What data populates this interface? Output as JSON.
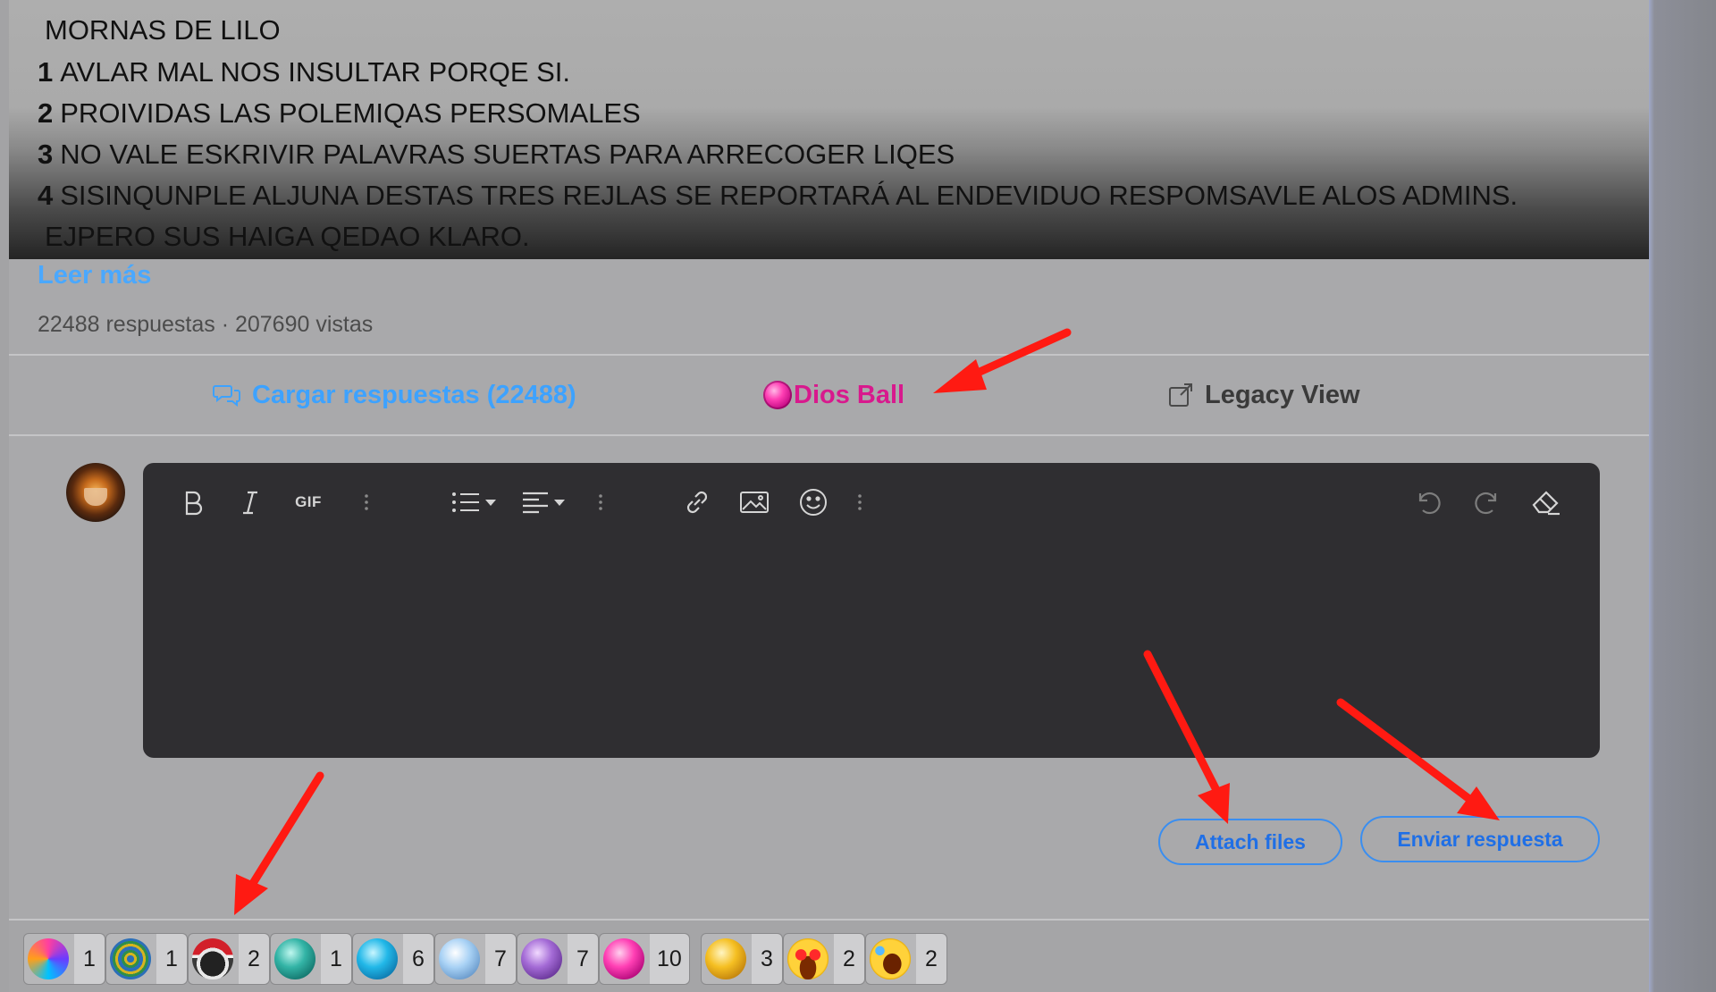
{
  "post": {
    "rules": [
      {
        "num": "",
        "text": "MORNAS DE LILO"
      },
      {
        "num": "1",
        "text": "AVLAR MAL NOS INSULTAR PORQE SI."
      },
      {
        "num": "2",
        "text": "PROIVIDAS LAS POLEMIQAS PERSOMALES"
      },
      {
        "num": "3",
        "text": "NO VALE ESKRIVIR PALAVRAS SUERTAS PARA ARRECOGER LIQES"
      },
      {
        "num": "4",
        "text": "SISINQUNPLE ALJUNA DESTAS TRES REJLAS SE REPORTARÁ AL ENDEVIDUO RESPOMSAVLE ALOS ADMINS."
      },
      {
        "num": "",
        "text": "EJPERO SUS HAIGA QEDAO KLARO."
      }
    ],
    "read_more": "Leer más",
    "stats": "22488 respuestas · 207690 vistas"
  },
  "actions": {
    "load_replies": "Cargar respuestas (22488)",
    "dios_ball": "Dios Ball",
    "legacy_view": "Legacy View"
  },
  "toolbar": {
    "gif": "GIF"
  },
  "buttons": {
    "attach": "Attach files",
    "send": "Enviar respuesta"
  },
  "reactions": [
    {
      "icon": "spiral-galaxy-icon",
      "count": "1"
    },
    {
      "icon": "maze-globe-icon",
      "count": "1"
    },
    {
      "icon": "santa-robot-icon",
      "count": "2"
    },
    {
      "icon": "teal-gem-icon",
      "count": "1"
    },
    {
      "icon": "cyan-gem-icon",
      "count": "6"
    },
    {
      "icon": "light-blue-gem-icon",
      "count": "7"
    },
    {
      "icon": "purple-gem-icon",
      "count": "7"
    },
    {
      "icon": "pink-gem-icon",
      "count": "10"
    },
    {
      "icon": "gold-gem-icon",
      "count": "3"
    },
    {
      "icon": "heart-eyes-emoji-icon",
      "count": "2"
    },
    {
      "icon": "rofl-emoji-icon",
      "count": "2"
    }
  ],
  "colors": {
    "link_blue": "#3da2ff",
    "dios_pink": "#d8198d",
    "button_blue": "#1f6fe6",
    "editor_bg": "#2f2e31",
    "arrow_red": "#ff1a12"
  }
}
